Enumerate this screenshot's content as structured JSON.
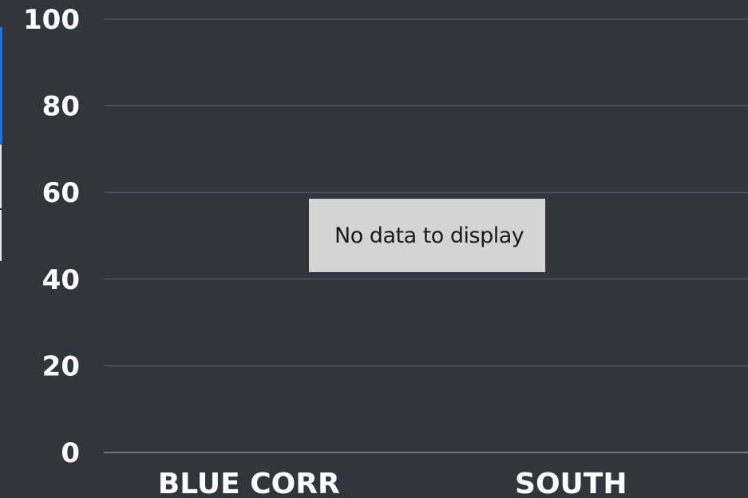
{
  "chart_data": {
    "type": "bar",
    "categories": [
      "BLUE CORR",
      "SOUTH"
    ],
    "series": [],
    "yticks": [
      "0",
      "20",
      "40",
      "60",
      "80",
      "100"
    ],
    "ylim": [
      0,
      100
    ],
    "grid": true,
    "message": "No data to display"
  },
  "colors": {
    "background": "#33353c",
    "grid": "#5d6068",
    "text": "#ffffff",
    "message_box": "#d4d4d4",
    "accent": "#1f6fe5"
  }
}
